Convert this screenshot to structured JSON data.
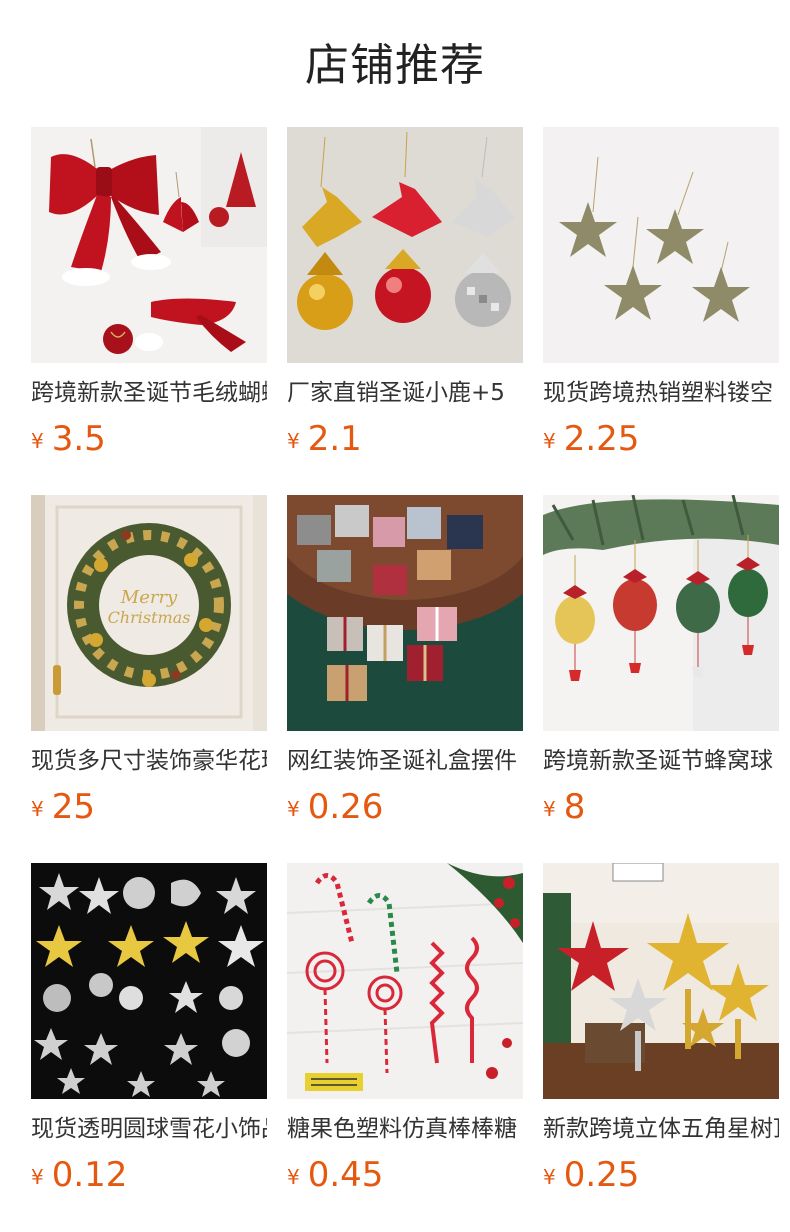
{
  "page": {
    "title": "店铺推荐"
  },
  "colors": {
    "price": "#e4580f",
    "text": "#333333"
  },
  "products": [
    {
      "title": "跨境新款圣诞节毛绒蝴蝶结",
      "currency": "¥",
      "price": "3.5",
      "image_icon": "red-bow-ornaments-image"
    },
    {
      "title": "厂家直销圣诞小鹿+5",
      "currency": "¥",
      "price": "2.1",
      "image_icon": "reindeer-ball-ornaments-image"
    },
    {
      "title": "现货跨境热销塑料镂空",
      "currency": "¥",
      "price": "2.25",
      "image_icon": "glitter-star-ornaments-image"
    },
    {
      "title": "现货多尺寸装饰豪华花环",
      "currency": "¥",
      "price": "25",
      "image_icon": "christmas-wreath-image"
    },
    {
      "title": "网红装饰圣诞礼盒摆件",
      "currency": "¥",
      "price": "0.26",
      "image_icon": "gift-boxes-image"
    },
    {
      "title": "跨境新款圣诞节蜂窝球",
      "currency": "¥",
      "price": "8",
      "image_icon": "honeycomb-ball-ornaments-image"
    },
    {
      "title": "现货透明圆球雪花小饰品",
      "currency": "¥",
      "price": "0.12",
      "image_icon": "clear-acrylic-ornaments-image"
    },
    {
      "title": "糖果色塑料仿真棒棒糖",
      "currency": "¥",
      "price": "0.45",
      "image_icon": "candy-cane-ornaments-image"
    },
    {
      "title": "新款跨境立体五角星树顶",
      "currency": "¥",
      "price": "0.25",
      "image_icon": "tree-topper-stars-image"
    }
  ]
}
